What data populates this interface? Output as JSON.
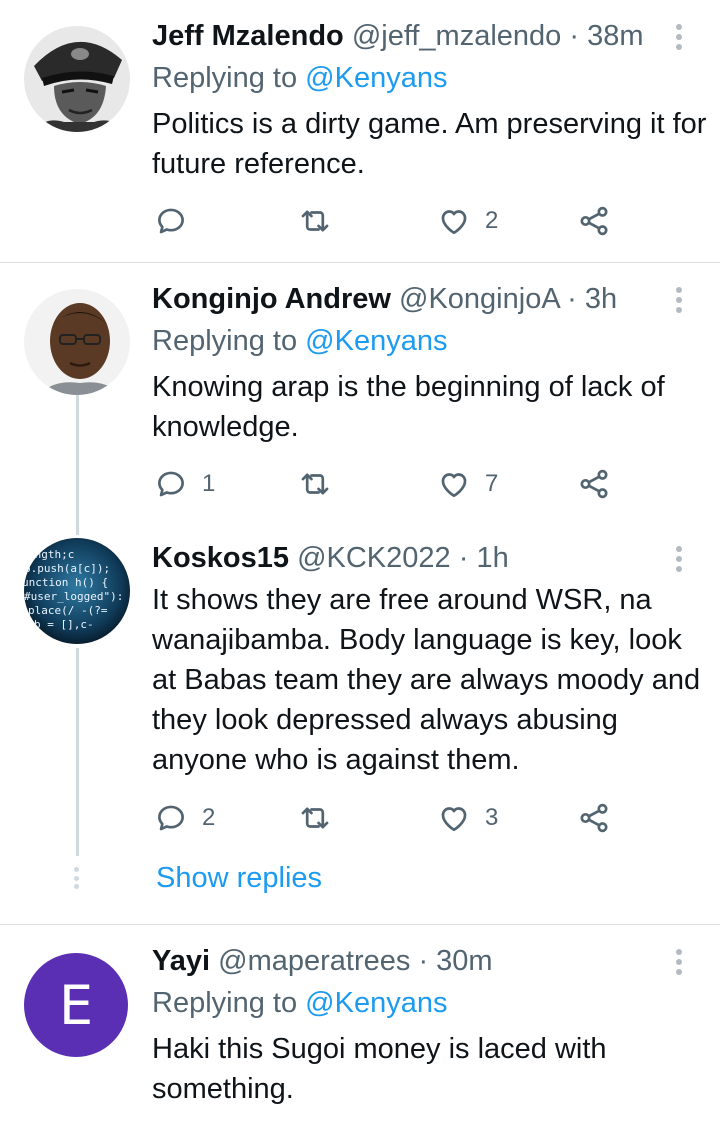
{
  "tweets": [
    {
      "name": "Jeff Mzalendo",
      "handle": "@jeff_mzalendo",
      "sep": "·",
      "time": "38m",
      "replying_prefix": "Replying to ",
      "replying_to": "@Kenyans",
      "text": "Politics is a dirty game. Am preserving it for future reference.",
      "reply_count": "",
      "retweet_count": "",
      "like_count": "2",
      "avatar_icon": "avatar-military-cap-portrait"
    },
    {
      "name": "Konginjo Andrew",
      "handle": "@KonginjoA",
      "sep": "·",
      "time": "3h",
      "replying_prefix": "Replying to ",
      "replying_to": "@Kenyans",
      "text": "Knowing arap is the beginning of lack of knowledge.",
      "reply_count": "1",
      "retweet_count": "",
      "like_count": "7",
      "avatar_icon": "avatar-portrait"
    },
    {
      "name": "Koskos15",
      "handle": "@KCK2022",
      "sep": "·",
      "time": "1h",
      "text": "It shows they are free around WSR, na wanajibamba. Body language is key, look at Babas team they are always moody and they look depressed always abusing anyone who is against them.",
      "reply_count": "2",
      "retweet_count": "",
      "like_count": "3",
      "avatar_icon": "avatar-code-globe"
    },
    {
      "name": "Yayi",
      "handle": "@maperatrees",
      "sep": "·",
      "time": "30m",
      "replying_prefix": "Replying to ",
      "replying_to": "@Kenyans",
      "text": "Haki this Sugoi money is laced with something.",
      "avatar_letter": "E",
      "avatar_color": "#5b2fb3"
    }
  ],
  "show_replies_label": "Show replies",
  "colors": {
    "accent": "#1d9bf0",
    "secondary_text": "#536471",
    "primary_text": "#0f1419"
  },
  "icons": [
    "reply-icon",
    "retweet-icon",
    "like-icon",
    "share-icon",
    "more-icon"
  ]
}
